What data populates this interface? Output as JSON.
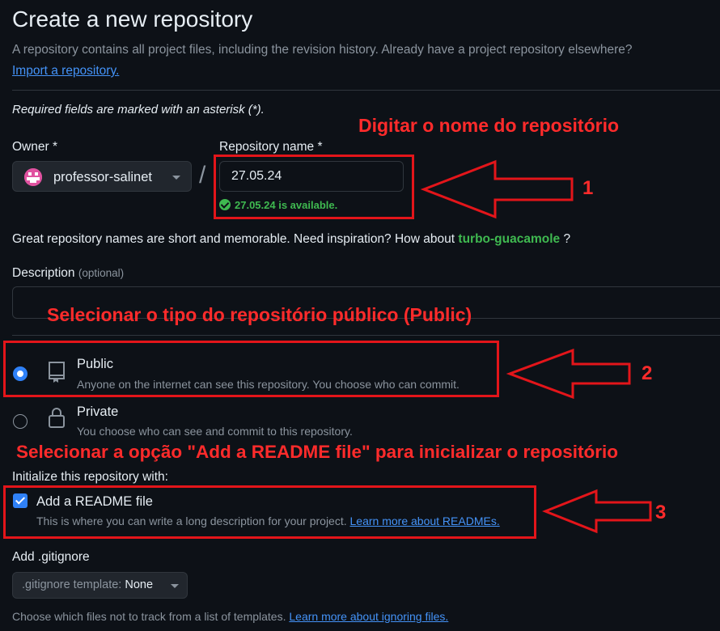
{
  "header": {
    "title": "Create a new repository",
    "subtitle": "A repository contains all project files, including the revision history. Already have a project repository elsewhere?",
    "import_link": "Import a repository."
  },
  "required_note": "Required fields are marked with an asterisk (*).",
  "owner": {
    "label": "Owner *",
    "value": "professor-salinet"
  },
  "repo_name": {
    "label": "Repository name *",
    "value": "27.05.24",
    "availability": "27.05.24 is available."
  },
  "name_tip": {
    "text": "Great repository names are short and memorable. Need inspiration? How about",
    "suggestion": "turbo-guacamole",
    "end": "?"
  },
  "description": {
    "label": "Description",
    "optional": "(optional)",
    "value": ""
  },
  "visibility": {
    "public": {
      "title": "Public",
      "desc": "Anyone on the internet can see this repository. You choose who can commit.",
      "selected": true
    },
    "private": {
      "title": "Private",
      "desc": "You choose who can see and commit to this repository.",
      "selected": false
    }
  },
  "initialize": {
    "heading": "Initialize this repository with:",
    "readme": {
      "label": "Add a README file",
      "desc": "This is where you can write a long description for your project.",
      "link": "Learn more about READMEs.",
      "checked": true
    }
  },
  "gitignore": {
    "label": "Add .gitignore",
    "select_prefix": ".gitignore template:",
    "select_value": "None",
    "help": "Choose which files not to track from a list of templates.",
    "help_link": "Learn more about ignoring files."
  },
  "annotations": {
    "a1_text": "Digitar o nome do repositório",
    "a1_num": "1",
    "a2_text": "Selecionar o tipo do repositório público (Public)",
    "a2_num": "2",
    "a3_text": "Selecionar a opção \"Add a README file\" para inicializar o repositório",
    "a3_num": "3",
    "color": "#e3151a"
  },
  "colors": {
    "background": "#0d1117",
    "accent": "#2f81f7",
    "success": "#3fb950",
    "link": "#4493f8"
  }
}
